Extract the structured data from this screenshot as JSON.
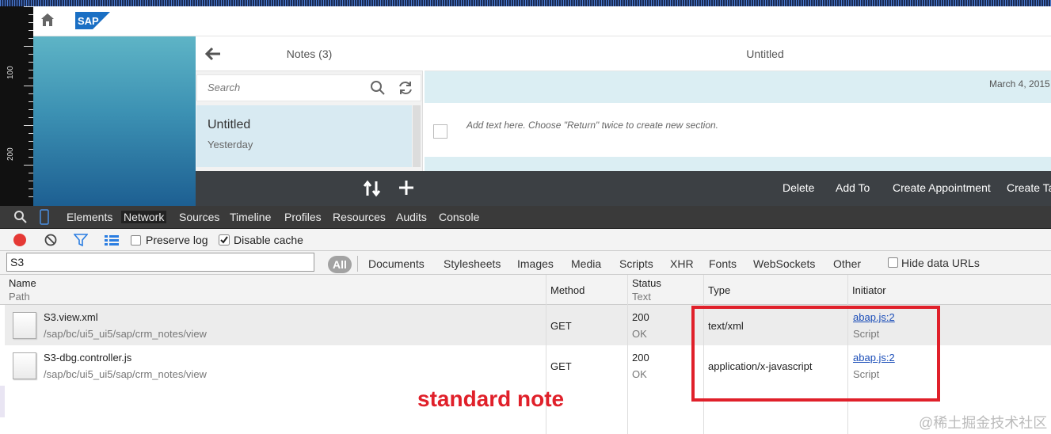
{
  "ruler": {
    "labels": [
      "100",
      "200"
    ]
  },
  "master": {
    "title": "Notes (3)",
    "search_placeholder": "Search",
    "item": {
      "title": "Untitled",
      "date": "Yesterday"
    }
  },
  "detail": {
    "title": "Untitled",
    "date": "March 4, 2015",
    "placeholder": "Add text here. Choose \"Return\" twice to create new section."
  },
  "toolbar": {
    "delete": "Delete",
    "add_to": "Add To",
    "create_appointment": "Create Appointment",
    "create_task": "Create Ta"
  },
  "devtools": {
    "tabs": [
      "Elements",
      "Network",
      "Sources",
      "Timeline",
      "Profiles",
      "Resources",
      "Audits",
      "Console"
    ],
    "active_tab": "Network",
    "preserve_log": "Preserve log",
    "disable_cache": "Disable cache",
    "filter_value": "S3",
    "filter_all": "All",
    "filter_types": [
      "Documents",
      "Stylesheets",
      "Images",
      "Media",
      "Scripts",
      "XHR",
      "Fonts",
      "WebSockets",
      "Other"
    ],
    "hide_data_urls": "Hide data URLs",
    "columns": {
      "name": "Name",
      "path": "Path",
      "method": "Method",
      "status": "Status",
      "text": "Text",
      "type": "Type",
      "initiator": "Initiator"
    },
    "rows": [
      {
        "name": "S3.view.xml",
        "path": "/sap/bc/ui5_ui5/sap/crm_notes/view",
        "method": "GET",
        "status": "200",
        "status_text": "OK",
        "type": "text/xml",
        "initiator": "abap.js:2",
        "initiator_sub": "Script"
      },
      {
        "name": "S3-dbg.controller.js",
        "path": "/sap/bc/ui5_ui5/sap/crm_notes/view",
        "method": "GET",
        "status": "200",
        "status_text": "OK",
        "type": "application/x-javascript",
        "initiator": "abap.js:2",
        "initiator_sub": "Script"
      }
    ]
  },
  "annotation": "standard note",
  "watermark": "@稀土掘金技术社区",
  "colors": {
    "annotation": "#e0202a",
    "toolbar": "#3c4044",
    "devtools_tabs": "#3a3a3a"
  }
}
